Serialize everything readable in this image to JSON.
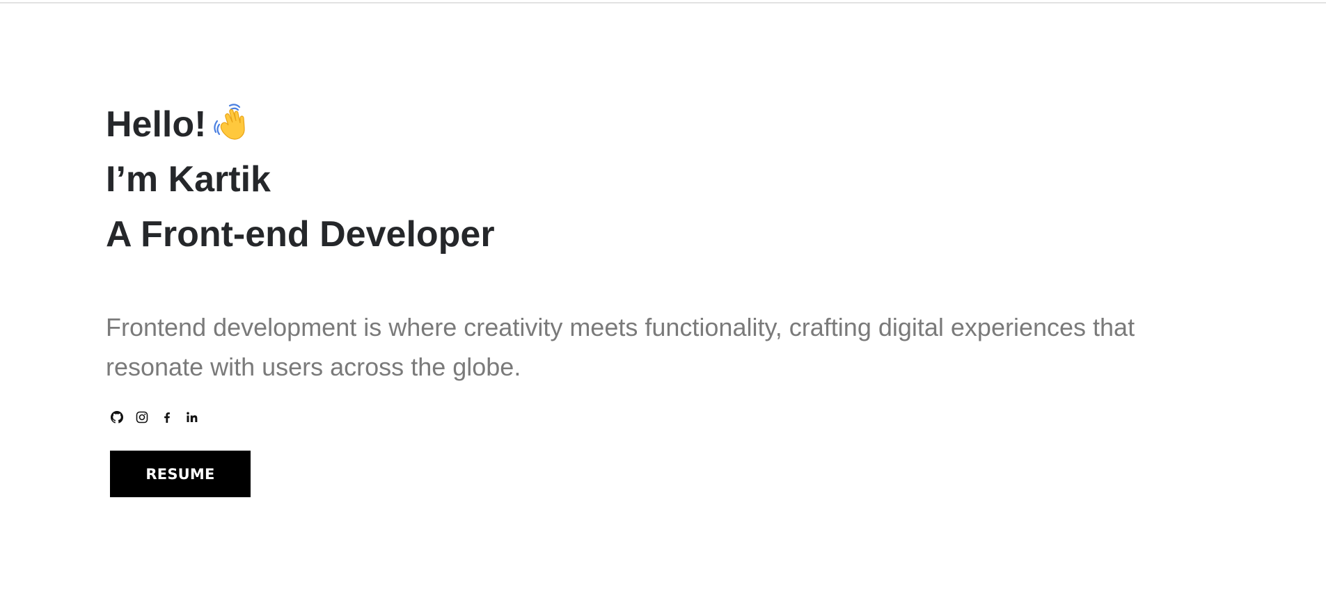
{
  "hero": {
    "greeting": "Hello!",
    "name_line": "I’m Kartik",
    "role_line": "A Front-end Developer",
    "wave_icon": "waving-hand-emoji"
  },
  "tagline": "Frontend development is where creativity meets functionality, crafting digital experiences that resonate with users across the globe.",
  "socials": [
    {
      "icon": "github-icon"
    },
    {
      "icon": "instagram-icon"
    },
    {
      "icon": "facebook-icon"
    },
    {
      "icon": "linkedin-icon"
    }
  ],
  "resume_button": {
    "label": "RESUME"
  },
  "colors": {
    "heading": "#25272a",
    "body_text": "#7a7a7a",
    "button_bg": "#000000",
    "button_text": "#ffffff",
    "wave_yellow": "#FFC83D",
    "wave_lines": "#4A7FE0"
  }
}
